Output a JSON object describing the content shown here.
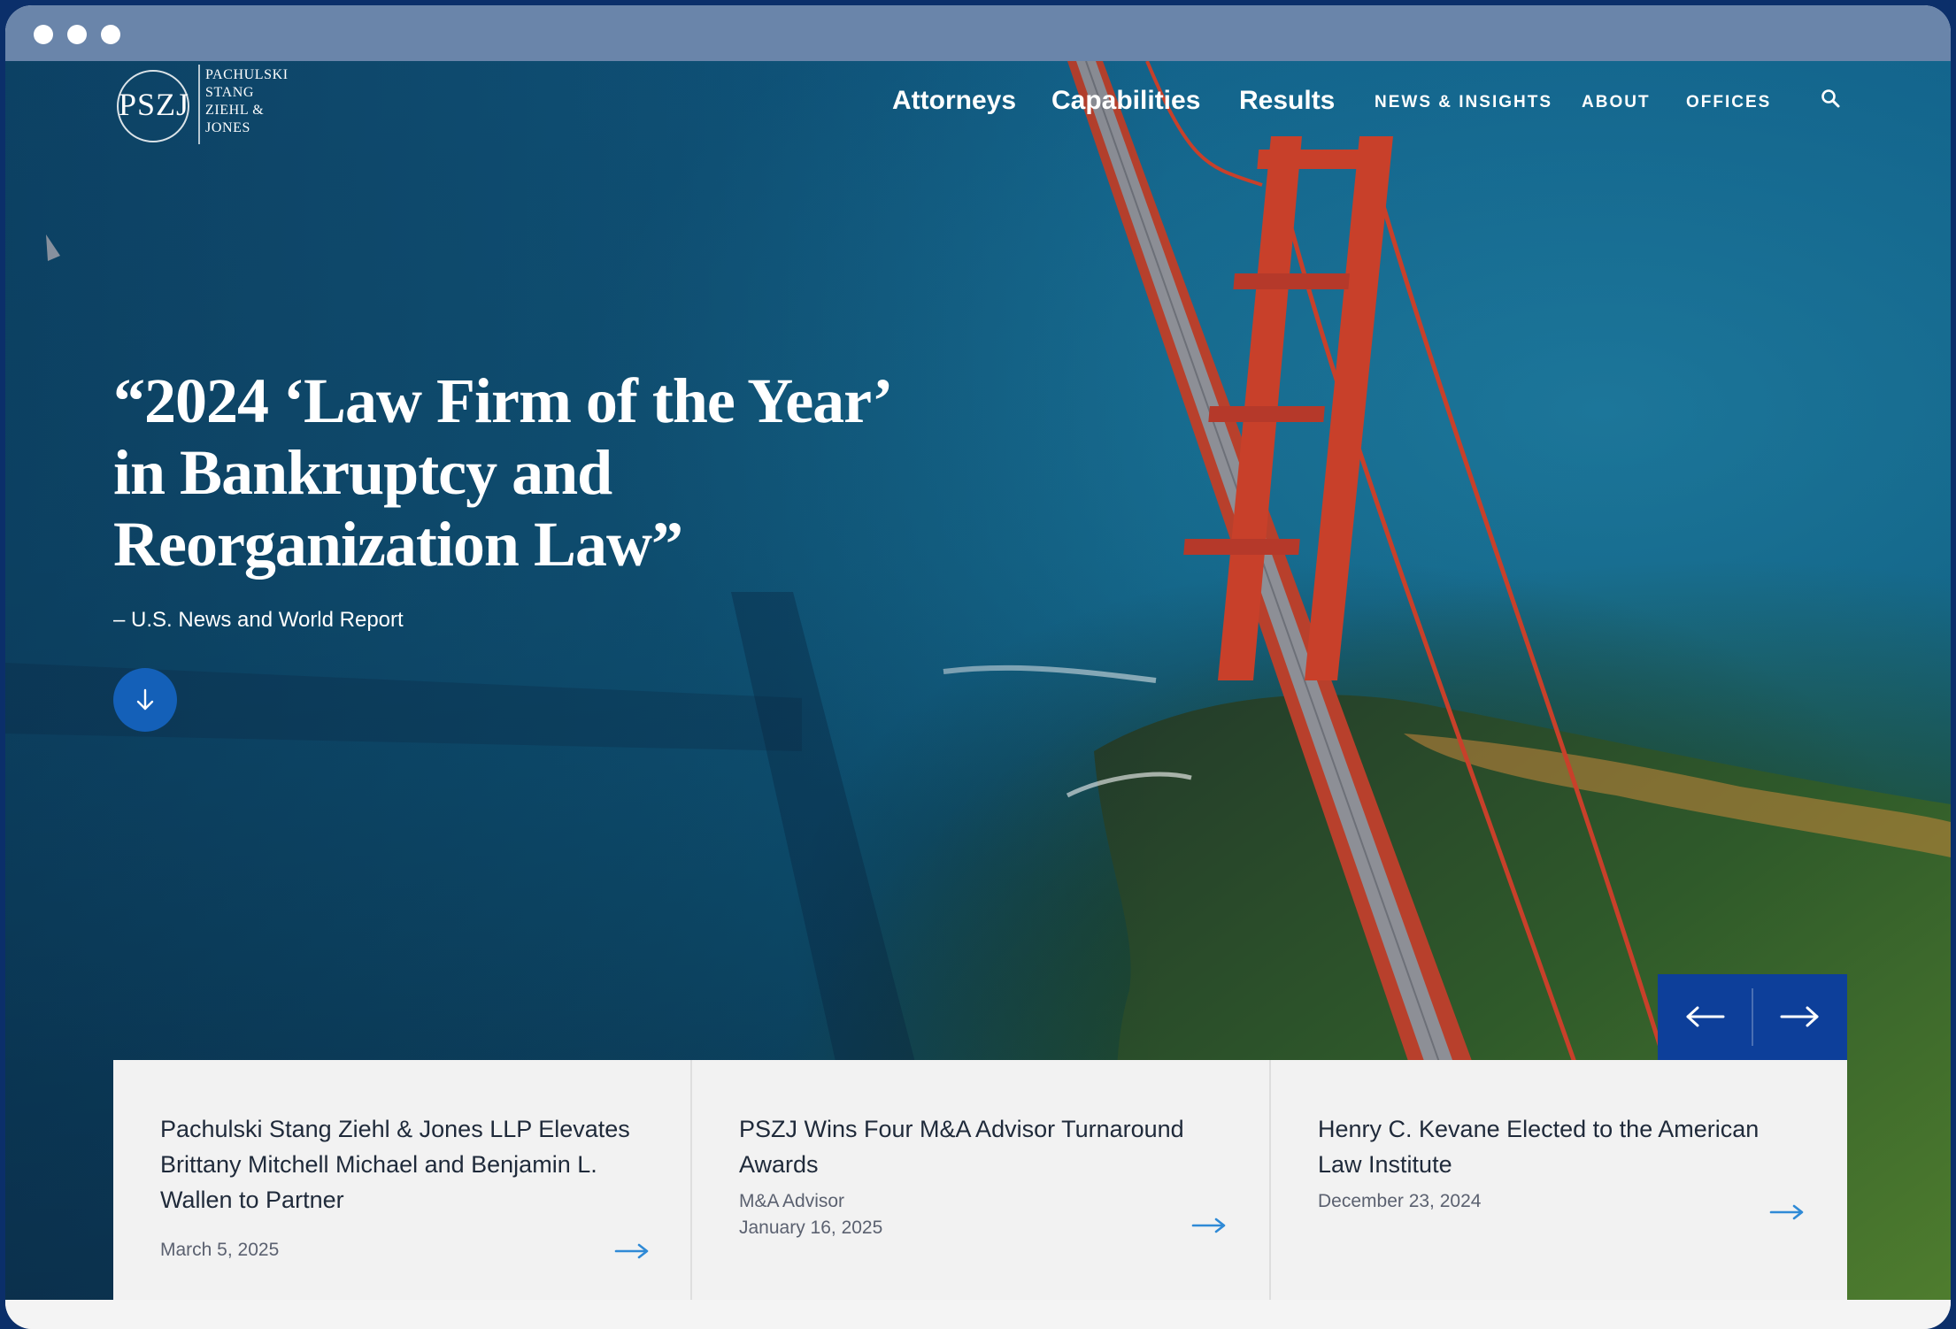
{
  "window": {
    "controls": [
      "close",
      "minimize",
      "maximize"
    ]
  },
  "logo": {
    "mark": "PSZJ",
    "lines": [
      "PACHULSKI",
      "STANG",
      "ZIEHL &",
      "JONES"
    ]
  },
  "nav": {
    "items": [
      {
        "label": "Attorneys"
      },
      {
        "label": "Capabilities"
      },
      {
        "label": "Results"
      },
      {
        "label": "NEWS & INSIGHTS"
      },
      {
        "label": "ABOUT"
      },
      {
        "label": "OFFICES"
      }
    ],
    "search_icon": "search-icon"
  },
  "hero": {
    "headline": "“2024 ‘Law Firm of the Year’ in Bankruptcy and Reorganization Law”",
    "attribution": "– U.S. News and World Report",
    "scroll_icon": "arrow-down-icon"
  },
  "carousel": {
    "prev_icon": "arrow-left-icon",
    "next_icon": "arrow-right-icon",
    "accent": "#0d3f9a"
  },
  "news": [
    {
      "title": "Pachulski Stang Ziehl & Jones LLP Elevates Brittany Mitchell Michael and Benjamin L. Wallen to Partner",
      "source": "",
      "date": "March 5, 2025"
    },
    {
      "title": "PSZJ Wins Four M&A Advisor Turnaround Awards",
      "source": "M&A Advisor",
      "date": "January 16, 2025"
    },
    {
      "title": "Henry C. Kevane Elected to the American Law Institute",
      "source": "",
      "date": "December 23, 2024"
    }
  ],
  "colors": {
    "brand_blue": "#1460b8",
    "card_arrow": "#2f8ad6",
    "chrome": "#6a85aa",
    "bridge_red": "#c8402a"
  }
}
